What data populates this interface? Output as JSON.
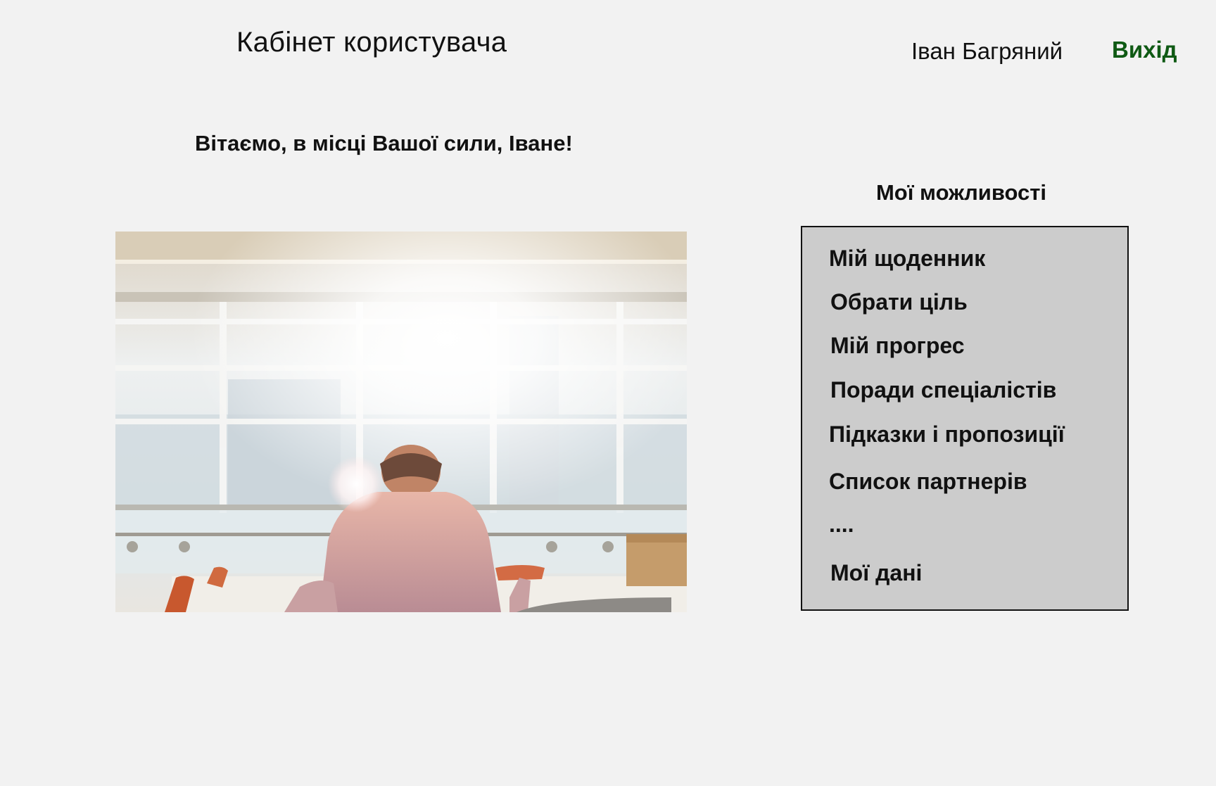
{
  "header": {
    "title": "Кабінет користувача",
    "user_name": "Іван Багряний",
    "logout_label": "Вихід"
  },
  "main": {
    "greeting": "Вітаємо, в місці Вашої сили, Іване!"
  },
  "features": {
    "title": "Мої можливості",
    "items": [
      {
        "label": "Мій щоденник"
      },
      {
        "label": "Обрати ціль"
      },
      {
        "label": "Мій прогрес"
      },
      {
        "label": "Поради спеціалістів"
      },
      {
        "label": "Підказки і пропозиції"
      },
      {
        "label": "Список партнерів"
      },
      {
        "label": "...."
      },
      {
        "label": "Мої дані"
      }
    ]
  },
  "colors": {
    "background": "#f2f2f2",
    "logout": "#0f5a14",
    "menu_background": "#cccccc"
  }
}
